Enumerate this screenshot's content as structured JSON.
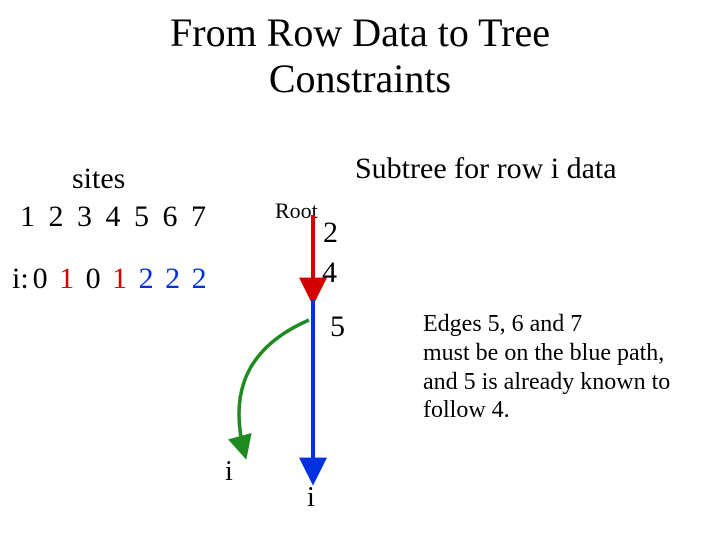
{
  "title_line1": "From Row Data to Tree",
  "title_line2": "Constraints",
  "sites_label": "sites",
  "sites_numbers": "1 2 3 4 5 6 7",
  "row_i_prefix": "i:",
  "row_i_values": [
    {
      "v": "0",
      "c": "black"
    },
    {
      "v": "1",
      "c": "red"
    },
    {
      "v": "0",
      "c": "black"
    },
    {
      "v": "1",
      "c": "red"
    },
    {
      "v": "2",
      "c": "blue"
    },
    {
      "v": "2",
      "c": "blue"
    },
    {
      "v": "2",
      "c": "blue"
    }
  ],
  "subtree_title": "Subtree for row i data",
  "root_label": "Root",
  "edge_labels": {
    "e2": "2",
    "e4": "4",
    "e5": "5"
  },
  "leaf_label": "i",
  "caption": "Edges 5, 6 and 7\nmust be on the blue path,\nand 5 is already known to\nfollow 4.",
  "colors": {
    "red": "#d40000",
    "blue": "#0030e0",
    "green": "#1f8a1f"
  }
}
